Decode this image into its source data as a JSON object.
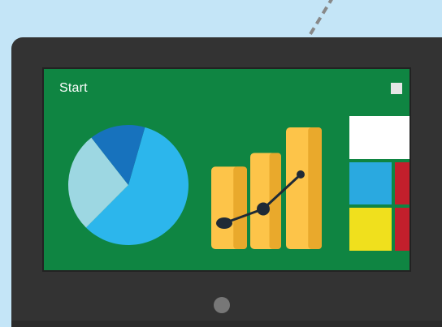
{
  "screen": {
    "start_label": "Start",
    "background_color": "#0f8542"
  },
  "icons": {
    "maximize": "window-square-icon",
    "home": "home-button-icon"
  },
  "chart_data": [
    {
      "type": "pie",
      "colors": [
        "#2cb6ec",
        "#9dd7e2",
        "#1772bd"
      ],
      "values": [
        58,
        27,
        15
      ]
    },
    {
      "type": "bar",
      "bar_color": "#fdc449",
      "values": [
        42,
        49,
        62
      ],
      "trend_points": [
        52,
        66,
        100
      ]
    }
  ],
  "tiles": [
    {
      "color": "#ffffff"
    },
    {
      "color": "#2aa9e0"
    },
    {
      "color": "#c21f2c"
    },
    {
      "color": "#f0e01d"
    },
    {
      "color": "#c21f2c"
    }
  ]
}
